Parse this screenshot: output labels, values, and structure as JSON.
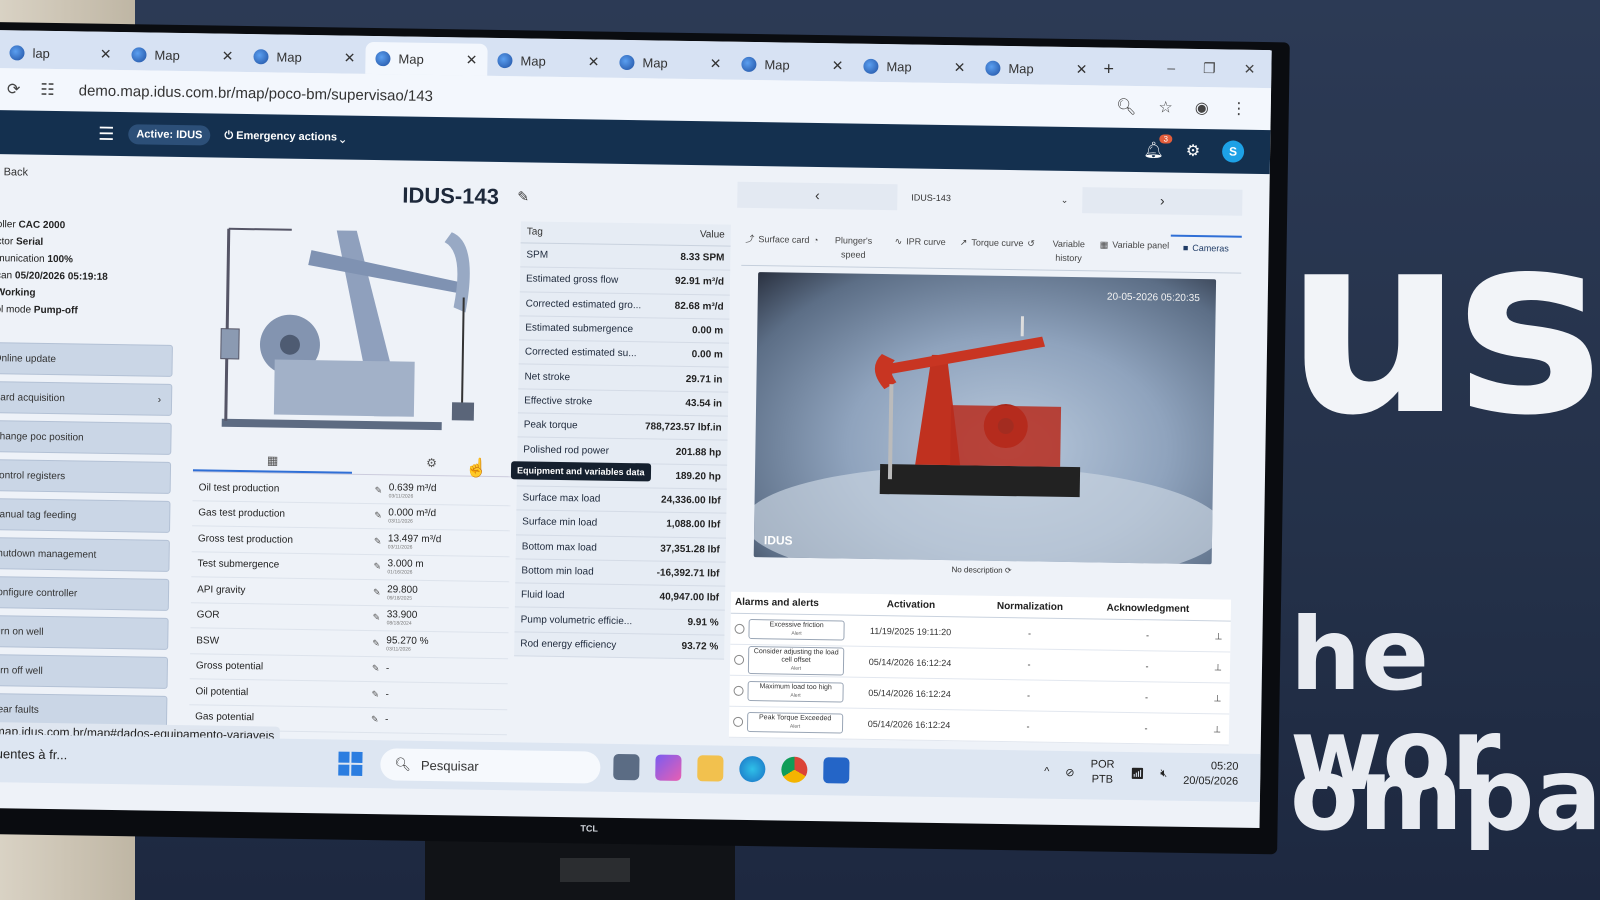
{
  "browser": {
    "tabs": [
      {
        "label": "lap"
      },
      {
        "label": "Map"
      },
      {
        "label": "Map"
      },
      {
        "label": "Map",
        "active": true
      },
      {
        "label": "Map"
      },
      {
        "label": "Map"
      },
      {
        "label": "Map"
      },
      {
        "label": "Map"
      },
      {
        "label": "Map"
      }
    ],
    "new_tab": "+",
    "url": "demo.map.idus.com.br/map/poco-bm/supervisao/143"
  },
  "header": {
    "active_label": "Active: IDUS",
    "emergency_label": "Emergency actions",
    "notifications_count": "3",
    "avatar_initial": "S"
  },
  "left": {
    "back_label": "Back",
    "info": [
      {
        "label": "oller",
        "value": "CAC 2000"
      },
      {
        "label": "ctor",
        "value": "Serial"
      },
      {
        "label": "munication",
        "value": "100%"
      },
      {
        "label": "can",
        "value": "05/20/2026 05:19:18"
      },
      {
        "label": "",
        "value": "Working"
      },
      {
        "label": "ol mode",
        "value": "Pump-off"
      }
    ],
    "actions": [
      {
        "label": "Online update",
        "chevron": ""
      },
      {
        "label": "Card acquisition",
        "chevron": "›"
      },
      {
        "label": "Change poc position",
        "chevron": ""
      },
      {
        "label": "Control registers",
        "chevron": ""
      },
      {
        "label": "Manual tag feeding",
        "chevron": ""
      },
      {
        "label": "Shutdown management",
        "chevron": ""
      },
      {
        "label": "Configure controller",
        "chevron": ""
      },
      {
        "label": "Turn on well",
        "chevron": ""
      },
      {
        "label": "Turn off well",
        "chevron": ""
      },
      {
        "label": "Clear faults",
        "chevron": ""
      }
    ],
    "status_url": "map.idus.com.br/map#dados-equipamento-variaveis"
  },
  "center": {
    "title": "IDUS-143",
    "production": [
      {
        "name": "Oil test production",
        "value": "0.639 m³/d",
        "date": "03/11/2026"
      },
      {
        "name": "Gas test production",
        "value": "0.000 m³/d",
        "date": "03/11/2026"
      },
      {
        "name": "Gross test production",
        "value": "13.497 m³/d",
        "date": "03/11/2026"
      },
      {
        "name": "Test submergence",
        "value": "3.000 m",
        "date": "01/16/2026"
      },
      {
        "name": "API gravity",
        "value": "29.800",
        "date": "09/18/2025"
      },
      {
        "name": "GOR",
        "value": "33.900",
        "date": "08/18/2024"
      },
      {
        "name": "BSW",
        "value": "95.270 %",
        "date": "03/11/2026"
      },
      {
        "name": "Gross potential",
        "value": "-",
        "date": ""
      },
      {
        "name": "Oil potential",
        "value": "-",
        "date": ""
      },
      {
        "name": "Gas potential",
        "value": "-",
        "date": ""
      }
    ],
    "tag_header": {
      "tag": "Tag",
      "value": "Value"
    },
    "tags": [
      {
        "tag": "SPM",
        "value": "8.33 SPM"
      },
      {
        "tag": "Estimated gross flow",
        "value": "92.91 m³/d"
      },
      {
        "tag": "Corrected estimated gro...",
        "value": "82.68 m³/d"
      },
      {
        "tag": "Estimated submergence",
        "value": "0.00 m"
      },
      {
        "tag": "Corrected estimated su...",
        "value": "0.00 m"
      },
      {
        "tag": "Net stroke",
        "value": "29.71 in"
      },
      {
        "tag": "Effective stroke",
        "value": "43.54 in"
      },
      {
        "tag": "Peak torque",
        "value": "788,723.57 lbf.in"
      },
      {
        "tag": "Polished rod power",
        "value": "201.88 hp"
      },
      {
        "tag": "Pump power",
        "value": "189.20 hp"
      },
      {
        "tag": "Surface max load",
        "value": "24,336.00 lbf"
      },
      {
        "tag": "Surface min load",
        "value": "1,088.00 lbf"
      },
      {
        "tag": "Bottom max load",
        "value": "37,351.28 lbf"
      },
      {
        "tag": "Bottom min load",
        "value": "-16,392.71 lbf"
      },
      {
        "tag": "Fluid load",
        "value": "40,947.00 lbf"
      },
      {
        "tag": "Pump volumetric efficie...",
        "value": "9.91 %"
      },
      {
        "tag": "Rod energy efficiency",
        "value": "93.72 %"
      }
    ],
    "tooltip": "Equipment and variables data"
  },
  "right": {
    "well_select": "IDUS-143",
    "tools": [
      {
        "label": "Surface card"
      },
      {
        "label": "Plunger's speed"
      },
      {
        "label": "IPR curve"
      },
      {
        "label": "Torque curve"
      },
      {
        "label": "Variable history"
      },
      {
        "label": "Variable panel"
      },
      {
        "label": "Cameras",
        "active": true
      }
    ],
    "camera_timestamp": "20-05-2026 05:20:35",
    "camera_watermark": "IDUS",
    "camera_caption": "No description",
    "alarms_header": [
      "Alarms and alerts",
      "Activation",
      "Normalization",
      "Acknowledgment"
    ],
    "alarms": [
      {
        "name": "Excessive friction",
        "kind": "Alert",
        "activation": "11/19/2025 19:11:20",
        "normalization": "-",
        "ack": "-"
      },
      {
        "name": "Consider adjusting the load cell offset",
        "kind": "Alert",
        "activation": "05/14/2026 16:12:24",
        "normalization": "-",
        "ack": "-"
      },
      {
        "name": "Maximum load too high",
        "kind": "Alert",
        "activation": "05/14/2026 16:12:24",
        "normalization": "-",
        "ack": "-"
      },
      {
        "name": "Peak Torque Exceeded",
        "kind": "Alert",
        "activation": "05/14/2026 16:12:24",
        "normalization": "-",
        "ack": "-"
      }
    ]
  },
  "taskbar": {
    "news": "quentes à fr...",
    "search_placeholder": "Pesquisar",
    "lang_1": "POR",
    "lang_2": "PTB",
    "time": "05:20",
    "date": "20/05/2026"
  },
  "backdrop": {
    "brand": "us",
    "slogan_1": "he wor",
    "slogan_2": "ompan"
  },
  "monitor_brand": "TCL"
}
